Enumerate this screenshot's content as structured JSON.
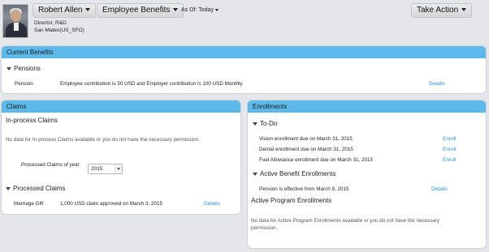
{
  "header": {
    "employee_name": "Robert Allen",
    "page_menu": "Employee Benefits",
    "as_of": "As Of: Today",
    "take_action": "Take Action",
    "title_line": "Director, R&D",
    "location_line": "San Mateo(US_SFO)"
  },
  "current_benefits": {
    "title": "Current Benefits",
    "section": "Pensions",
    "row_label": "Pension",
    "row_text": "Employee contribution is 50 USD and Employer contribution is 100 USD Monthly",
    "details": "Details"
  },
  "claims": {
    "title": "Claims",
    "in_process_title": "In-process Claims",
    "no_data": "No data for In-process Claims available or you do not have the necessary permission.",
    "year_label": "Processed Claims of year",
    "year_value": "2015",
    "processed_title": "Processed Claims",
    "row_label": "Marriage Gift",
    "row_text": "1,000 USD claim approved on March 3, 2015",
    "details": "Details"
  },
  "enrollments": {
    "title": "Enrollments",
    "todo_title": "To-Do",
    "todo_items": [
      {
        "text": "Vision enrollment due on March 31, 2015",
        "action": "Enroll"
      },
      {
        "text": "Dental enrollment due on March 31, 2015",
        "action": "Enroll"
      },
      {
        "text": "Fuel Allowance enrollment due on March 31, 2015",
        "action": "Enroll"
      }
    ],
    "active_title": "Active Benefit Enrollments",
    "active_text": "Pension is effective from March 9, 2015",
    "active_details": "Details",
    "program_title": "Active Program Enrollments",
    "program_no_data_line1": "No data for Active Program Enrollments available or you do not have the necessary",
    "program_no_data_line2": "permission."
  },
  "colors": {
    "panel_header": "#5eb9eb",
    "link": "#2a8fd6",
    "background": "#e4e6ea"
  }
}
